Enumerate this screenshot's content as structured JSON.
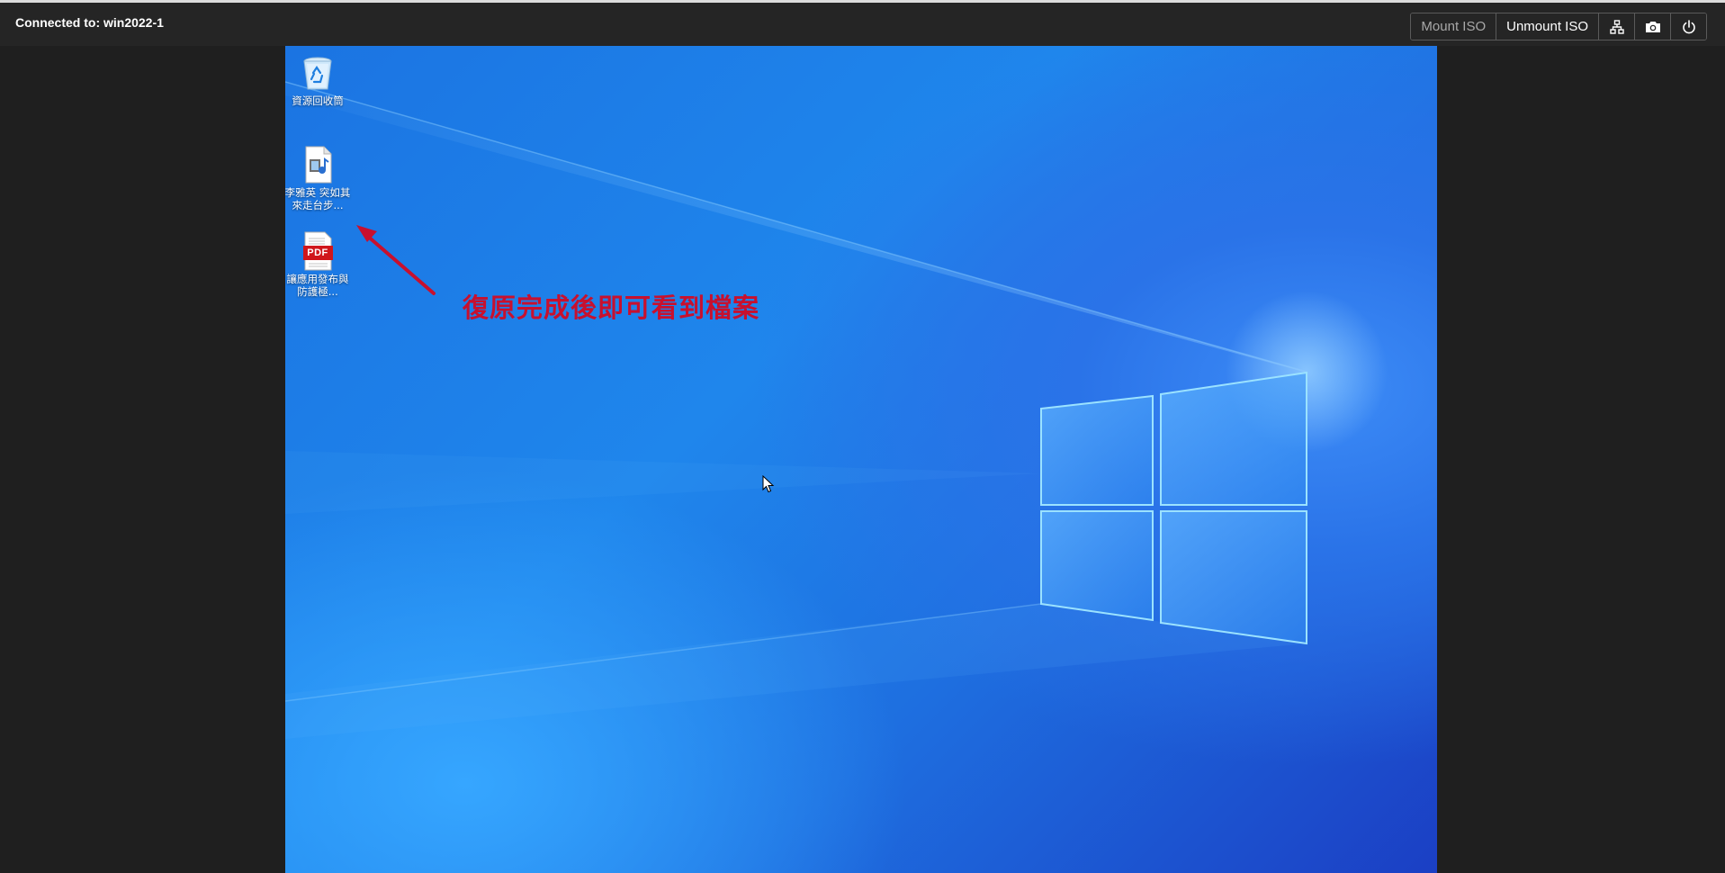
{
  "topbar": {
    "connection_label": "Connected to: win2022-1"
  },
  "toolbar": {
    "mount_iso": "Mount ISO",
    "unmount_iso": "Unmount ISO",
    "network_icon": "network-icon",
    "screenshot_icon": "camera-icon",
    "power_icon": "power-icon"
  },
  "desktop": {
    "icons": [
      {
        "label": "資源回收筒",
        "icon": "recycle-bin-icon"
      },
      {
        "label": "李雅英 突如其來走台步...",
        "icon": "video-file-icon"
      },
      {
        "label": "讓應用發布與防護極...",
        "icon": "pdf-file-icon",
        "badge": "PDF"
      }
    ],
    "annotation_text": "復原完成後即可看到檔案",
    "annotation_color": "#c8102e"
  }
}
